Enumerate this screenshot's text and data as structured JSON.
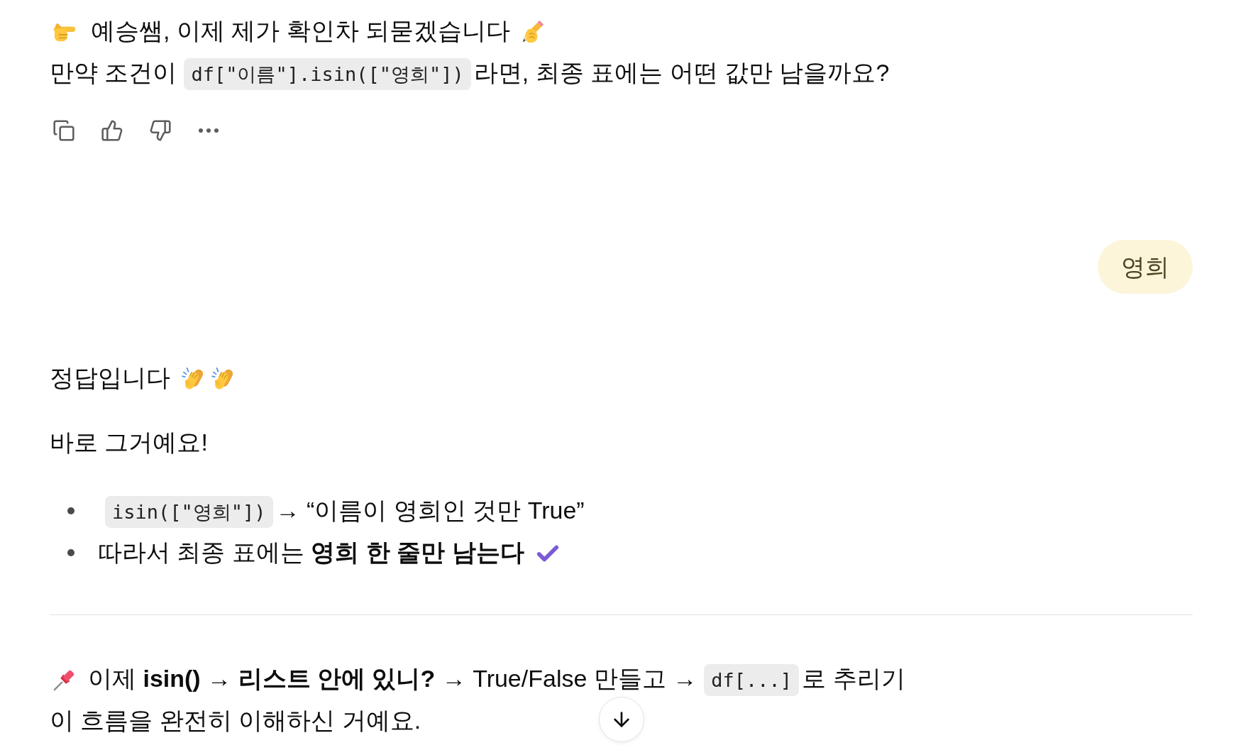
{
  "assistant_question": {
    "lines": [
      [
        {
          "kind": "text",
          "text": "예승쌤, 이제 제가 확인차 되묻겠습니다"
        }
      ],
      [
        {
          "kind": "text",
          "text": "만약 조건이"
        },
        {
          "kind": "code",
          "text": "df[\"이름\"].isin([\"영희\"])"
        },
        {
          "kind": "text",
          "text": "라면, 최종 표에는 어떤 값만 남을까요?"
        }
      ]
    ]
  },
  "user_reply": {
    "text": "영희"
  },
  "assistant_answer": {
    "paragraphs": [
      "정답입니다",
      "바로 그거예요!"
    ],
    "bullets": [
      [
        {
          "kind": "code",
          "text": "isin([\"영희\"])"
        },
        {
          "kind": "text",
          "text": "→ “이름이 영희인 것만 True”"
        }
      ],
      [
        {
          "kind": "text",
          "text": "따라서 최종 표에는 **영희 한 줄만 남는다**"
        }
      ]
    ],
    "summary_lines": [
      [
        {
          "kind": "text",
          "text": "이제 **isin() → 리스트 안에 있니?** → True/False 만들고 →"
        },
        {
          "kind": "code",
          "text": "df[...]"
        },
        {
          "kind": "text",
          "text": "로 추리기"
        }
      ],
      [
        {
          "kind": "text",
          "text": "이 흐름을 완전히 이해하신 거예요."
        }
      ]
    ]
  }
}
